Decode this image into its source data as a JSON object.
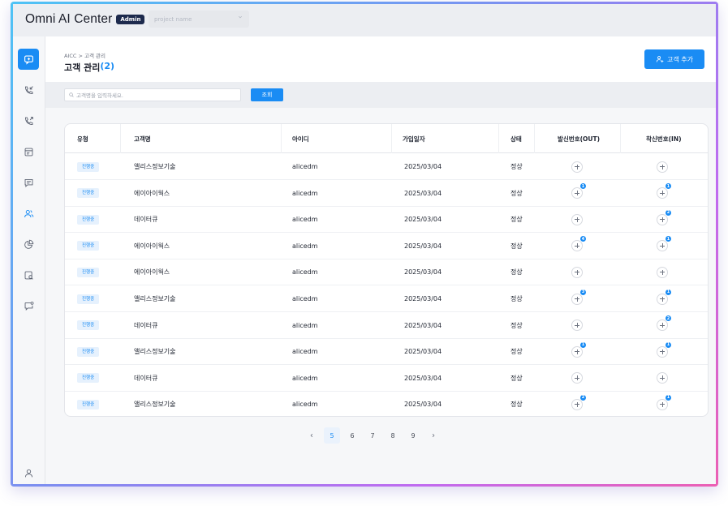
{
  "app": {
    "brand_regular": "Omni AI Center",
    "badge": "Admin"
  },
  "topbar": {
    "project_placeholder": "project name"
  },
  "sidebar": {
    "items": [
      {
        "icon": "chat-bubble-icon",
        "active": true
      },
      {
        "icon": "incoming-call-icon"
      },
      {
        "icon": "outgoing-call-icon"
      },
      {
        "icon": "window-icon"
      },
      {
        "icon": "message-icon"
      },
      {
        "icon": "users-icon"
      },
      {
        "icon": "pie-chart-icon"
      },
      {
        "icon": "search-doc-icon"
      },
      {
        "icon": "chat-settings-icon"
      }
    ],
    "bottom_icon": "user-profile-icon"
  },
  "header": {
    "breadcrumb": "AICC > 고객 관리",
    "title": "고객 관리",
    "count": "(2)",
    "add_button": "고객 추가"
  },
  "search": {
    "placeholder": "고객명을 입력하세요.",
    "button": "조회"
  },
  "table": {
    "columns": [
      "유형",
      "고객명",
      "아이디",
      "가입일자",
      "상태",
      "발신번호(OUT)",
      "착신번호(IN)"
    ],
    "rows": [
      {
        "type": "진행중",
        "name": "앨리스정보기술",
        "id": "alicedm",
        "date": "2025/03/04",
        "status": "정상",
        "out_badge": "",
        "in_badge": ""
      },
      {
        "type": "진행중",
        "name": "에이아이웍스",
        "id": "alicedm",
        "date": "2025/03/04",
        "status": "정상",
        "out_badge": "1",
        "in_badge": "1"
      },
      {
        "type": "진행중",
        "name": "데이터큐",
        "id": "alicedm",
        "date": "2025/03/04",
        "status": "정상",
        "out_badge": "",
        "in_badge": "2"
      },
      {
        "type": "진행중",
        "name": "에이아이웍스",
        "id": "alicedm",
        "date": "2025/03/04",
        "status": "정상",
        "out_badge": "4",
        "in_badge": "1"
      },
      {
        "type": "진행중",
        "name": "에이아이웍스",
        "id": "alicedm",
        "date": "2025/03/04",
        "status": "정상",
        "out_badge": "",
        "in_badge": ""
      },
      {
        "type": "진행중",
        "name": "앨리스정보기술",
        "id": "alicedm",
        "date": "2025/03/04",
        "status": "정상",
        "out_badge": "3",
        "in_badge": "1"
      },
      {
        "type": "진행중",
        "name": "데이터큐",
        "id": "alicedm",
        "date": "2025/03/04",
        "status": "정상",
        "out_badge": "",
        "in_badge": "2"
      },
      {
        "type": "진행중",
        "name": "앨리스정보기술",
        "id": "alicedm",
        "date": "2025/03/04",
        "status": "정상",
        "out_badge": "1",
        "in_badge": "1"
      },
      {
        "type": "진행중",
        "name": "데이터큐",
        "id": "alicedm",
        "date": "2025/03/04",
        "status": "정상",
        "out_badge": "",
        "in_badge": ""
      },
      {
        "type": "진행중",
        "name": "앨리스정보기술",
        "id": "alicedm",
        "date": "2025/03/04",
        "status": "정상",
        "out_badge": "2",
        "in_badge": "1"
      }
    ]
  },
  "pagination": {
    "pages": [
      "5",
      "6",
      "7",
      "8",
      "9"
    ],
    "current": "5"
  },
  "colors": {
    "accent": "#1a8cf4",
    "nav_dark": "#1d2a4d"
  }
}
